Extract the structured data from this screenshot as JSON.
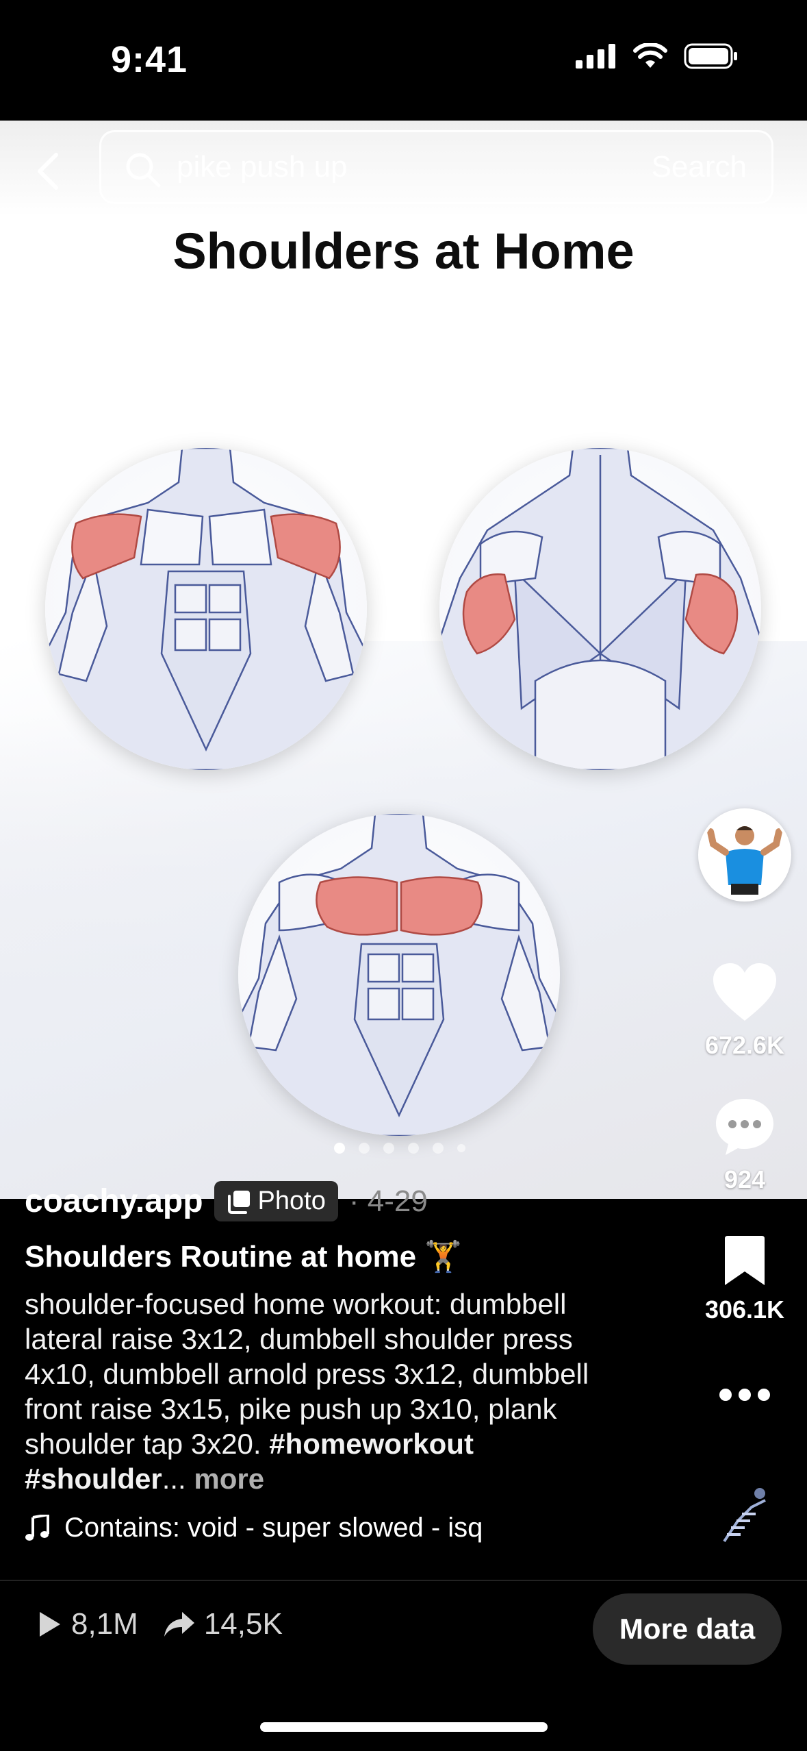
{
  "status_bar": {
    "time": "9:41"
  },
  "search": {
    "query": "pike push up",
    "button_label": "Search"
  },
  "photo": {
    "title": "Shoulders at Home",
    "highlight_color": "#e88a84",
    "carousel": {
      "total": 6,
      "active": 1
    }
  },
  "actions": {
    "likes": "672.6K",
    "comments": "924",
    "saves": "306.1K"
  },
  "post": {
    "author": "coachy.app",
    "badge": "Photo",
    "date": "· 4-29",
    "title": "Shoulders Routine at home 🏋️",
    "description": "shoulder-focused home workout: dumbbell lateral raise 3x12, dumbbell shoulder press 4x10, dumbbell arnold press 3x12, dumbbell front raise 3x15, pike push up 3x10, plank shoulder tap 3x20.",
    "hashtags": "#homeworkout #shoulder",
    "ellipsis": "...",
    "more_label": "more",
    "music": "Contains: void - super slowed - isq"
  },
  "bottom": {
    "plays": "8,1M",
    "shares": "14,5K",
    "more_data_label": "More data"
  }
}
